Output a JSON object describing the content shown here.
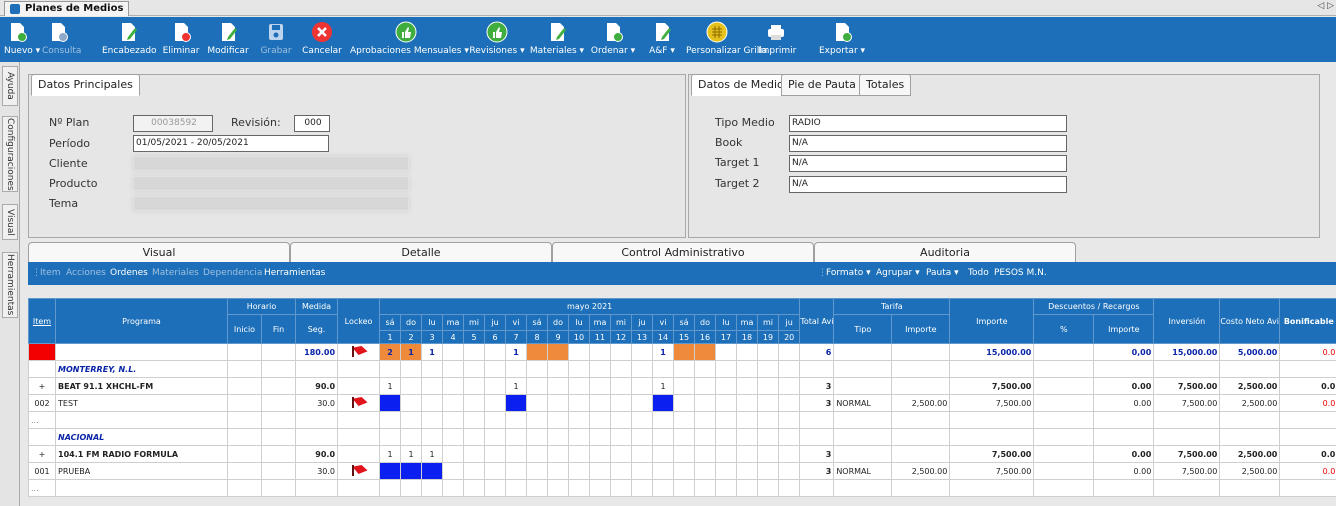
{
  "window": {
    "title": "Planes de Medios",
    "nav": "◁ ▷"
  },
  "toolbar": [
    {
      "label": "Nuevo ▾",
      "icon": "new-doc-icon",
      "enabled": true
    },
    {
      "label": "Consulta",
      "icon": "help-doc-icon",
      "enabled": false
    },
    {
      "label": "Encabezado",
      "icon": "edit-doc-icon",
      "enabled": true
    },
    {
      "label": "Eliminar",
      "icon": "delete-doc-icon",
      "enabled": true
    },
    {
      "label": "Modificar",
      "icon": "modify-doc-icon",
      "enabled": true
    },
    {
      "label": "Grabar",
      "icon": "save-icon",
      "enabled": false
    },
    {
      "label": "Cancelar",
      "icon": "cancel-icon",
      "enabled": true
    },
    {
      "label": "Aprobaciones Mensuales ▾",
      "icon": "thumbs-up-icon",
      "enabled": true
    },
    {
      "label": "Revisiones ▾",
      "icon": "thumbs-up-icon",
      "enabled": true
    },
    {
      "label": "Materiales ▾",
      "icon": "edit-doc-icon",
      "enabled": true
    },
    {
      "label": "Ordenar ▾",
      "icon": "order-doc-icon",
      "enabled": true
    },
    {
      "label": "A&F ▾",
      "icon": "edit-doc-icon",
      "enabled": true
    },
    {
      "label": "Personalizar Grilla",
      "icon": "grid-icon",
      "enabled": true
    },
    {
      "label": "Imprimir",
      "icon": "printer-icon",
      "enabled": true
    },
    {
      "label": "Exportar ▾",
      "icon": "export-icon",
      "enabled": true
    }
  ],
  "sidebar": [
    "Ayuda",
    "Configuraciones",
    "Visual",
    "Herramientas"
  ],
  "datos_principales": {
    "tab": "Datos Principales",
    "nplan_label": "Nº Plan",
    "nplan": "00038592",
    "revision_label": "Revisión:",
    "revision": "000",
    "periodo_label": "Período",
    "periodo": "01/05/2021 - 20/05/2021",
    "cliente_label": "Cliente",
    "producto_label": "Producto",
    "tema_label": "Tema"
  },
  "datos_medio": {
    "tabs": [
      "Datos de Medio",
      "Pie de Pauta",
      "Totales"
    ],
    "tipo_label": "Tipo Medio",
    "tipo": "RADIO",
    "book_label": "Book",
    "book": "N/A",
    "t1_label": "Target 1",
    "t1": "N/A",
    "t2_label": "Target 2",
    "t2": "N/A"
  },
  "section_tabs": [
    "Visual",
    "Detalle",
    "Control Administrativo",
    "Auditoria"
  ],
  "subbar": {
    "left": [
      "Item",
      "Acciones",
      "Ordenes",
      "Materiales",
      "Dependencia",
      "Herramientas"
    ],
    "left_active": [
      false,
      false,
      true,
      false,
      false,
      true
    ],
    "right": [
      "Formato ▾",
      "Agrupar ▾",
      "Pauta ▾",
      "Todo",
      "PESOS M.N."
    ]
  },
  "grid": {
    "h": {
      "item": "Item",
      "programa": "Programa",
      "horario": "Horario",
      "inicio": "Inicio",
      "fin": "Fin",
      "medida": "Medida",
      "seg": "Seg.",
      "lockeo": "Lockeo",
      "mes": "mayo 2021",
      "total": "Total Avisos",
      "tarifa": "Tarifa",
      "tipo": "Tipo",
      "importe": "Importe",
      "importe2": "Importe",
      "desc": "Descuentos / Recargos",
      "pct": "%",
      "importe3": "Importe",
      "inversion": "Inversión",
      "costo": "Costo Neto Aviso",
      "bonif": "Bonificable"
    },
    "days": [
      "sá",
      "do",
      "lu",
      "ma",
      "mi",
      "ju",
      "vi",
      "sá",
      "do",
      "lu",
      "ma",
      "mi",
      "ju",
      "vi",
      "sá",
      "do",
      "lu",
      "ma",
      "mi",
      "ju"
    ],
    "nums": [
      "1",
      "2",
      "3",
      "4",
      "5",
      "6",
      "7",
      "8",
      "9",
      "10",
      "11",
      "12",
      "13",
      "14",
      "15",
      "16",
      "17",
      "18",
      "19",
      "20"
    ],
    "rows": [
      {
        "kind": "total",
        "item": "",
        "prog": "",
        "med": "180.00",
        "flag": true,
        "days": {
          "0": "2",
          "1": "1",
          "2": "1",
          "6": "1",
          "13": "1"
        },
        "orange": [
          0,
          1,
          7,
          8,
          14,
          15
        ],
        "blue": [],
        "tot": "6",
        "tipo": "",
        "tarifa": "",
        "imp": "15,000.00",
        "pct": "",
        "dimp": "0,00",
        "inv": "15,000.00",
        "cost": "5,000.00",
        "bon": "0.0"
      },
      {
        "kind": "group",
        "item": "",
        "prog": "MONTERREY, N.L."
      },
      {
        "kind": "sub",
        "item": "+",
        "prog": "BEAT 91.1 XHCHL-FM",
        "med": "90.0",
        "flag": false,
        "days": {
          "0": "1",
          "6": "1",
          "13": "1"
        },
        "orange": [],
        "blue": [],
        "tot": "3",
        "tipo": "",
        "tarifa": "",
        "imp": "7,500.00",
        "pct": "",
        "dimp": "0.00",
        "inv": "7,500.00",
        "cost": "2,500.00",
        "bon": "0.0"
      },
      {
        "kind": "line",
        "item": "002",
        "prog": "TEST",
        "med": "30.0",
        "flag": true,
        "days": {
          "0": "1",
          "6": "1",
          "13": "1"
        },
        "orange": [],
        "blue": [
          0,
          6,
          13
        ],
        "tot": "3",
        "tipo": "NORMAL",
        "tarifa": "2,500.00",
        "imp": "7,500.00",
        "pct": "",
        "dimp": "0.00",
        "inv": "7,500.00",
        "cost": "2,500.00",
        "bon": "0.0"
      },
      {
        "kind": "blank",
        "item": "..."
      },
      {
        "kind": "group",
        "item": "",
        "prog": "NACIONAL"
      },
      {
        "kind": "sub",
        "item": "+",
        "prog": "104.1 FM RADIO FORMULA",
        "med": "90.0",
        "flag": false,
        "days": {
          "0": "1",
          "1": "1",
          "2": "1"
        },
        "orange": [],
        "blue": [],
        "tot": "3",
        "tipo": "",
        "tarifa": "",
        "imp": "7,500.00",
        "pct": "",
        "dimp": "0.00",
        "inv": "7,500.00",
        "cost": "2,500.00",
        "bon": "0.0"
      },
      {
        "kind": "line",
        "item": "001",
        "prog": "PRUEBA",
        "med": "30.0",
        "flag": true,
        "days": {
          "0": "1",
          "1": "1",
          "2": "1"
        },
        "orange": [],
        "blue": [
          0,
          1,
          2
        ],
        "tot": "3",
        "tipo": "NORMAL",
        "tarifa": "2,500.00",
        "imp": "7,500.00",
        "pct": "",
        "dimp": "0.00",
        "inv": "7,500.00",
        "cost": "2,500.00",
        "bon": "0.0"
      },
      {
        "kind": "blank",
        "item": "..."
      }
    ]
  }
}
